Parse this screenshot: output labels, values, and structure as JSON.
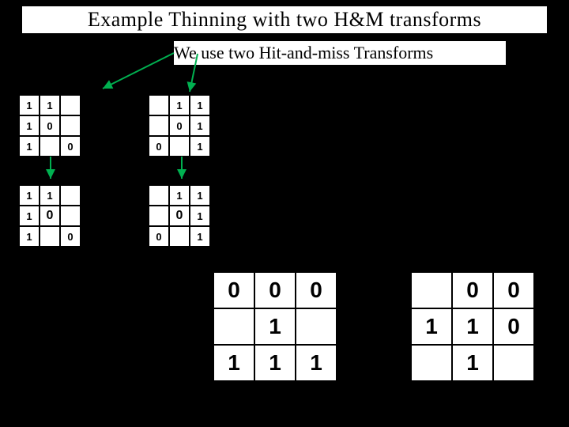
{
  "title": "Example Thinning with two H&M transforms",
  "subtitle": "We use two Hit-and-miss Transforms",
  "smallGrids": {
    "g1": [
      "1",
      "1",
      "",
      "1",
      "0",
      "",
      "1",
      "",
      "0"
    ],
    "g2": [
      "",
      "1",
      "1",
      "",
      "0",
      "1",
      "0",
      "",
      "1"
    ],
    "g3": [
      "1",
      "1",
      "",
      "1",
      "0",
      "",
      "1",
      "",
      "0"
    ],
    "g4": [
      "",
      "1",
      "1",
      "",
      "0",
      "1",
      "0",
      "",
      "1"
    ]
  },
  "bigGrids": {
    "b1": [
      "0",
      "0",
      "0",
      "",
      "1",
      "",
      "1",
      "1",
      "1"
    ],
    "b2": [
      "",
      "0",
      "0",
      "1",
      "1",
      "0",
      "",
      "1",
      ""
    ]
  },
  "colors": {
    "highlight": "#00b050",
    "arrow": "#00b050"
  }
}
